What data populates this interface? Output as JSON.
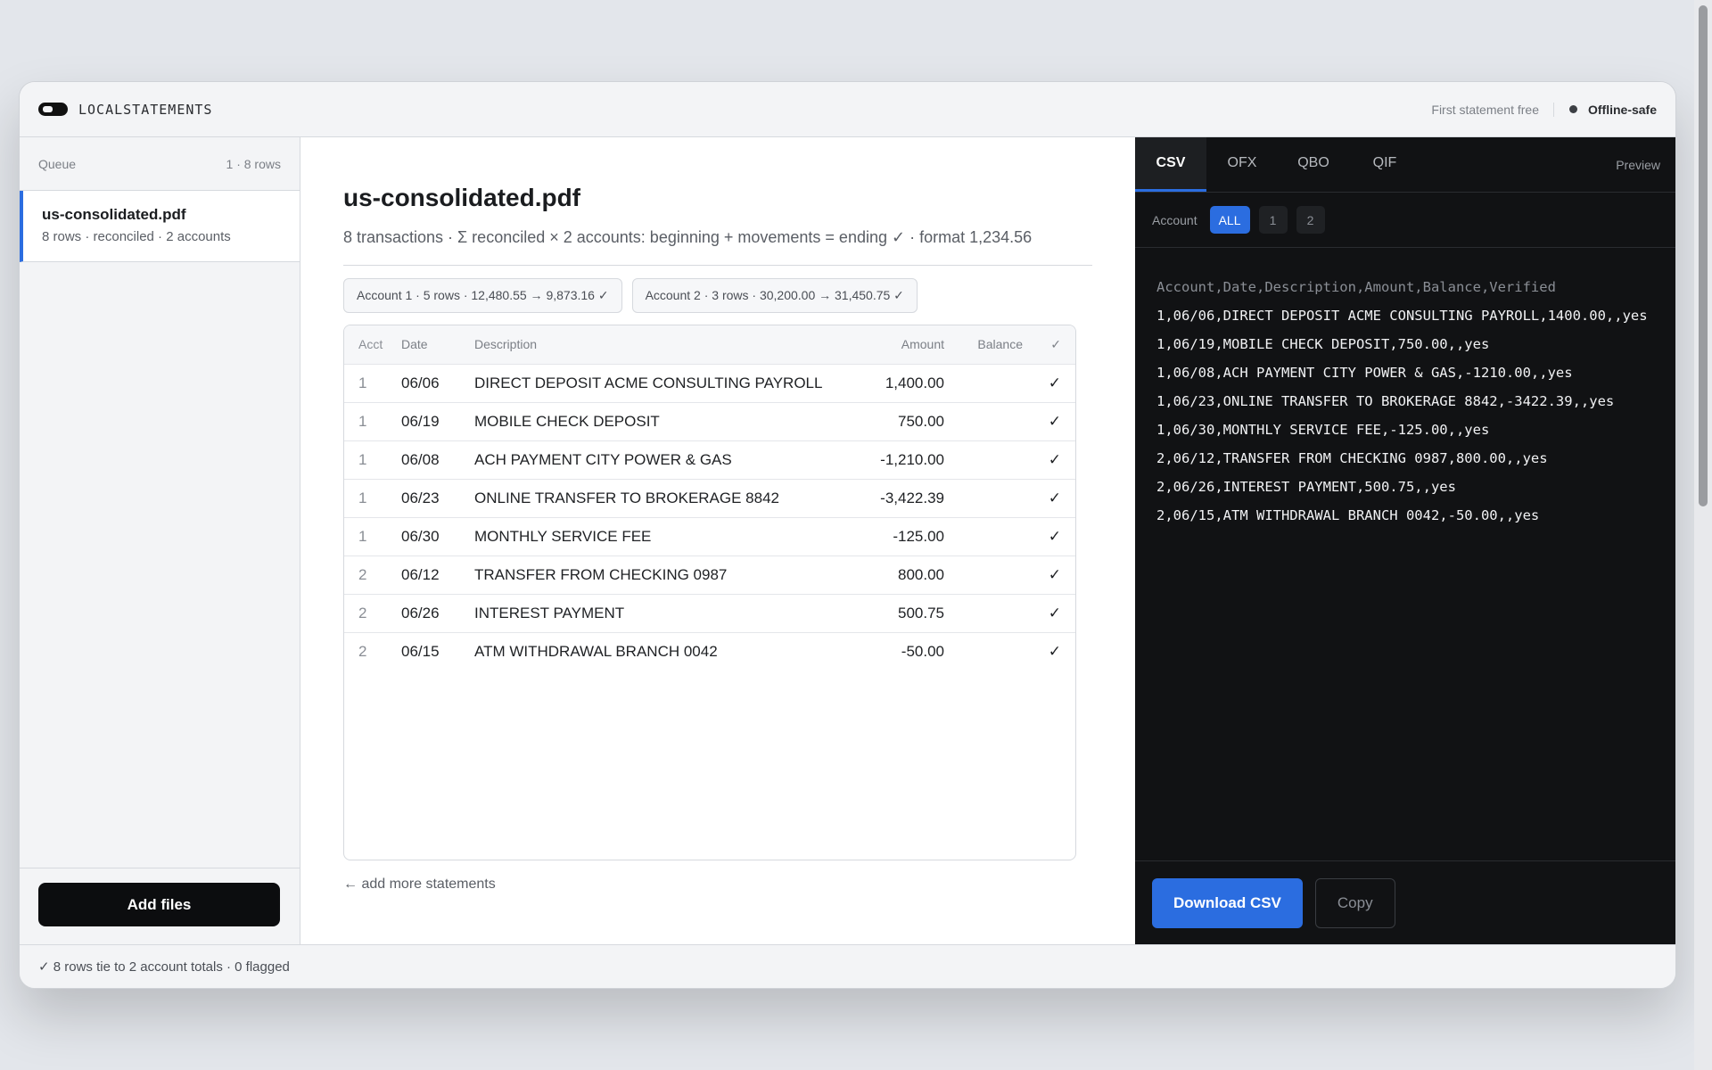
{
  "app": {
    "brand": "LOCALSTATEMENTS",
    "promo": "First statement free",
    "status": "Offline-safe"
  },
  "sidebar": {
    "queue_label": "Queue",
    "queue_count": "1 · 8 rows",
    "items": [
      {
        "name": "us-consolidated.pdf",
        "meta": "8 rows · reconciled · 2 accounts"
      }
    ],
    "add_button": "Add files"
  },
  "main": {
    "title": "us-consolidated.pdf",
    "subtitle": "8 transactions · Σ reconciled × 2 accounts: beginning + movements = ending ✓ · format 1,234.56",
    "chips": [
      "Account 1 · 5 rows · 12,480.55 → 9,873.16 ✓",
      "Account 2 · 3 rows · 30,200.00 → 31,450.75 ✓"
    ],
    "columns": {
      "acct": "Acct",
      "date": "Date",
      "desc": "Description",
      "amount": "Amount",
      "balance": "Balance",
      "check": "✓"
    },
    "rows": [
      {
        "acct": "1",
        "date": "06/06",
        "desc": "DIRECT DEPOSIT ACME CONSULTING PAYROLL",
        "amount": "1,400.00",
        "balance": "",
        "check": "✓"
      },
      {
        "acct": "1",
        "date": "06/19",
        "desc": "MOBILE CHECK DEPOSIT",
        "amount": "750.00",
        "balance": "",
        "check": "✓"
      },
      {
        "acct": "1",
        "date": "06/08",
        "desc": "ACH PAYMENT CITY POWER & GAS",
        "amount": "-1,210.00",
        "balance": "",
        "check": "✓"
      },
      {
        "acct": "1",
        "date": "06/23",
        "desc": "ONLINE TRANSFER TO BROKERAGE 8842",
        "amount": "-3,422.39",
        "balance": "",
        "check": "✓"
      },
      {
        "acct": "1",
        "date": "06/30",
        "desc": "MONTHLY SERVICE FEE",
        "amount": "-125.00",
        "balance": "",
        "check": "✓"
      },
      {
        "acct": "2",
        "date": "06/12",
        "desc": "TRANSFER FROM CHECKING 0987",
        "amount": "800.00",
        "balance": "",
        "check": "✓"
      },
      {
        "acct": "2",
        "date": "06/26",
        "desc": "INTEREST PAYMENT",
        "amount": "500.75",
        "balance": "",
        "check": "✓"
      },
      {
        "acct": "2",
        "date": "06/15",
        "desc": "ATM WITHDRAWAL BRANCH 0042",
        "amount": "-50.00",
        "balance": "",
        "check": "✓"
      }
    ],
    "add_more": "← add more statements"
  },
  "panel": {
    "tabs": [
      "CSV",
      "OFX",
      "QBO",
      "QIF"
    ],
    "active_tab": 0,
    "preview_label": "Preview",
    "account_label": "Account",
    "account_filters": [
      "ALL",
      "1",
      "2"
    ],
    "active_filter": 0,
    "csv_header": "Account,Date,Description,Amount,Balance,Verified",
    "csv_lines": [
      "1,06/06,DIRECT DEPOSIT ACME CONSULTING PAYROLL,1400.00,,yes",
      "1,06/19,MOBILE CHECK DEPOSIT,750.00,,yes",
      "1,06/08,ACH PAYMENT CITY POWER & GAS,-1210.00,,yes",
      "1,06/23,ONLINE TRANSFER TO BROKERAGE 8842,-3422.39,,yes",
      "1,06/30,MONTHLY SERVICE FEE,-125.00,,yes",
      "2,06/12,TRANSFER FROM CHECKING 0987,800.00,,yes",
      "2,06/26,INTEREST PAYMENT,500.75,,yes",
      "2,06/15,ATM WITHDRAWAL BRANCH 0042,-50.00,,yes"
    ],
    "download_button": "Download CSV",
    "copy_button": "Copy"
  },
  "statusbar": {
    "text": "✓ 8 rows tie to 2 account totals · 0 flagged"
  },
  "colors": {
    "accent": "#2b6de0",
    "panel_bg": "#111214",
    "primary_button": "#0c0d0f"
  }
}
